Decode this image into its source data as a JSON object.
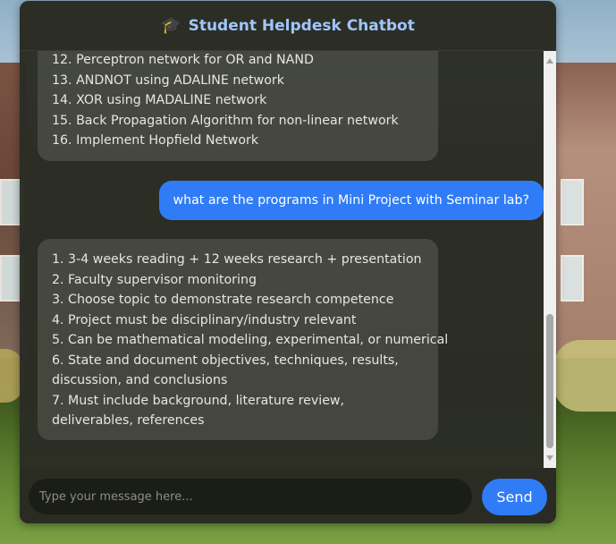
{
  "header": {
    "icon": "graduation-cap-icon",
    "title": "Student Helpdesk Chatbot"
  },
  "messages": {
    "bot_previous": [
      "12. Perceptron network for OR and NAND",
      "13. ANDNOT using ADALINE network",
      "14. XOR using MADALINE network",
      "15. Back Propagation Algorithm for non-linear network",
      "16. Implement Hopfield Network"
    ],
    "user_question": "what are the programs in Mini Project with Seminar lab?",
    "bot_answer": [
      "1. 3-4 weeks reading + 12 weeks research + presentation",
      "2. Faculty supervisor monitoring",
      "3. Choose topic to demonstrate research competence",
      "4. Project must be disciplinary/industry relevant",
      "5. Can be mathematical modeling, experimental, or numerical",
      "6. State and document objectives, techniques, results, discussion, and conclusions",
      "7. Must include background, literature review, deliverables, references"
    ]
  },
  "input": {
    "placeholder": "Type your message here...",
    "value": ""
  },
  "send_button": {
    "label": "Send"
  },
  "colors": {
    "accent": "#2f7cf6",
    "header_title": "#9fc6ff"
  }
}
